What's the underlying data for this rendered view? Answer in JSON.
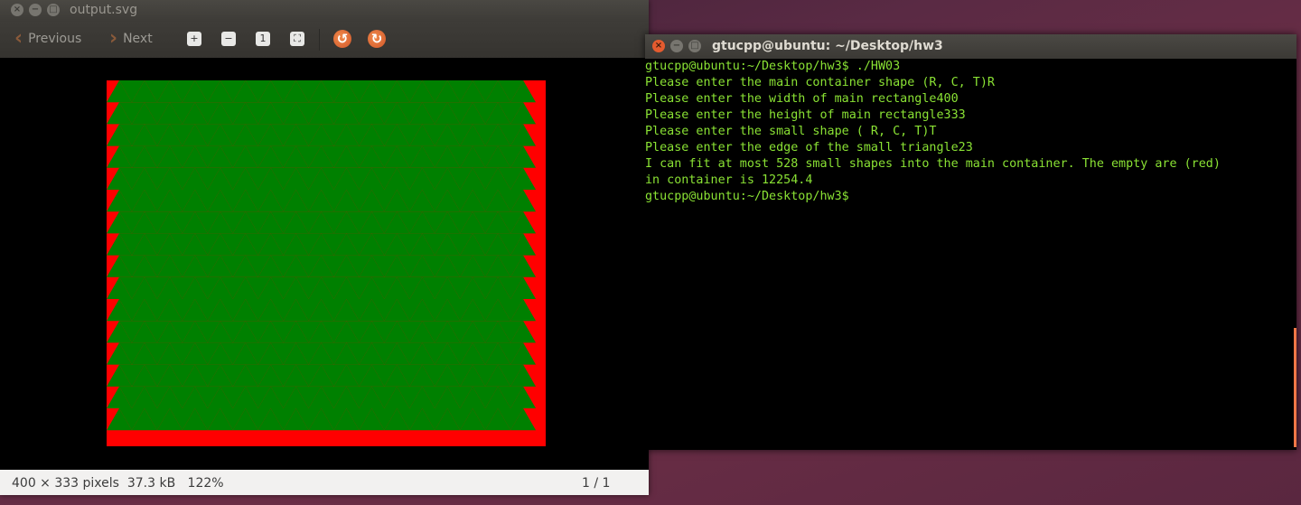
{
  "viewer": {
    "title": "output.svg",
    "toolbar": {
      "previous": "Previous",
      "next": "Next"
    },
    "status": {
      "info": "400 × 333 pixels  37.3 kB   122%",
      "page": "1 / 1"
    }
  },
  "terminal": {
    "title": "gtucpp@ubuntu: ~/Desktop/hw3",
    "lines": [
      "gtucpp@ubuntu:~/Desktop/hw3$ ./HW03",
      "Please enter the main container shape (R, C, T)R",
      "Please enter the width of main rectangle400",
      "Please enter the height of main rectangle333",
      "Please enter the small shape ( R, C, T)T",
      "Please enter the edge of the small triangle23",
      "I can fit at most 528 small shapes into the main container. The empty are (red)",
      "in container is 12254.4",
      "gtucpp@ubuntu:~/Desktop/hw3$ "
    ]
  },
  "colors": {
    "container": "#ff0000",
    "shapes": "#008000",
    "terminal_text": "#8ae234"
  },
  "icons": [
    "close-icon",
    "minimize-icon",
    "maximize-icon",
    "chevron-left-icon",
    "chevron-right-icon",
    "zoom-in-icon",
    "zoom-out-icon",
    "normal-size-icon",
    "best-fit-icon",
    "rotate-left-icon",
    "rotate-right-icon"
  ]
}
